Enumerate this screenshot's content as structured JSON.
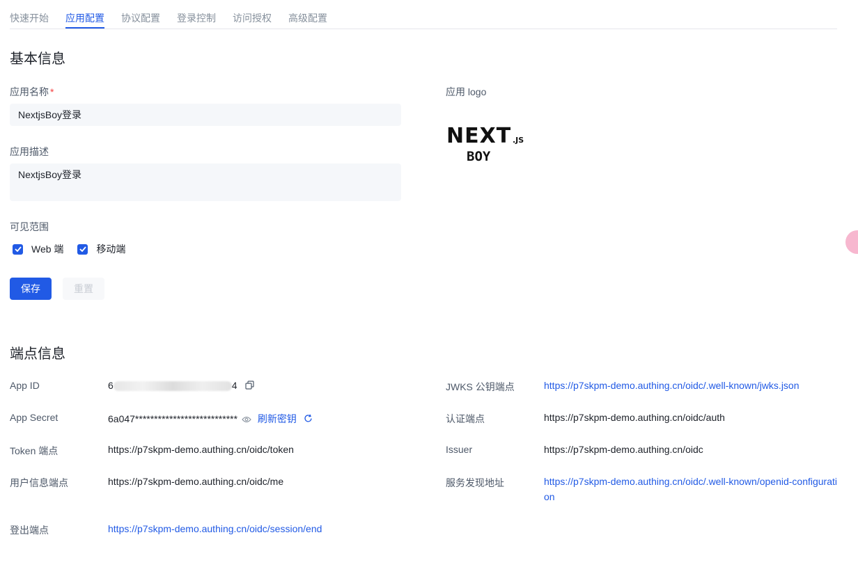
{
  "tabs": [
    "快速开始",
    "应用配置",
    "协议配置",
    "登录控制",
    "访问授权",
    "高级配置"
  ],
  "basic": {
    "title": "基本信息",
    "name_label": "应用名称",
    "required_mark": "*",
    "name_value": "NextjsBoy登录",
    "desc_label": "应用描述",
    "desc_value": "NextjsBoy登录",
    "logo_label": "应用 logo",
    "logo": {
      "main": "NEXT",
      "suffix": ".JS",
      "sub": "BOY"
    },
    "visibility_label": "可见范围",
    "visibility_options": [
      {
        "label": "Web 端",
        "checked": true
      },
      {
        "label": "移动端",
        "checked": true
      }
    ],
    "save_label": "保存",
    "reset_label": "重置"
  },
  "endpoints": {
    "title": "端点信息",
    "app_id_label": "App ID",
    "app_id_prefix": "6",
    "app_id_suffix": "4",
    "app_secret_label": "App Secret",
    "app_secret_value": "6a047***************************",
    "refresh_label": "刷新密钥",
    "token_label": "Token 端点",
    "token_value": "https://p7skpm-demo.authing.cn/oidc/token",
    "userinfo_label": "用户信息端点",
    "userinfo_value": "https://p7skpm-demo.authing.cn/oidc/me",
    "logout_label": "登出端点",
    "logout_value": "https://p7skpm-demo.authing.cn/oidc/session/end",
    "jwks_label": "JWKS 公钥端点",
    "jwks_value": "https://p7skpm-demo.authing.cn/oidc/.well-known/jwks.json",
    "auth_label": "认证端点",
    "auth_value": "https://p7skpm-demo.authing.cn/oidc/auth",
    "issuer_label": "Issuer",
    "issuer_value": "https://p7skpm-demo.authing.cn/oidc",
    "discovery_label": "服务发现地址",
    "discovery_value": "https://p7skpm-demo.authing.cn/oidc/.well-known/openid-configuration"
  },
  "colors": {
    "primary": "#215ae5",
    "input_bg": "#f5f7fa",
    "required": "#f53f3f"
  },
  "icons": [
    "copy-icon",
    "eye-icon",
    "refresh-icon",
    "check-icon"
  ]
}
